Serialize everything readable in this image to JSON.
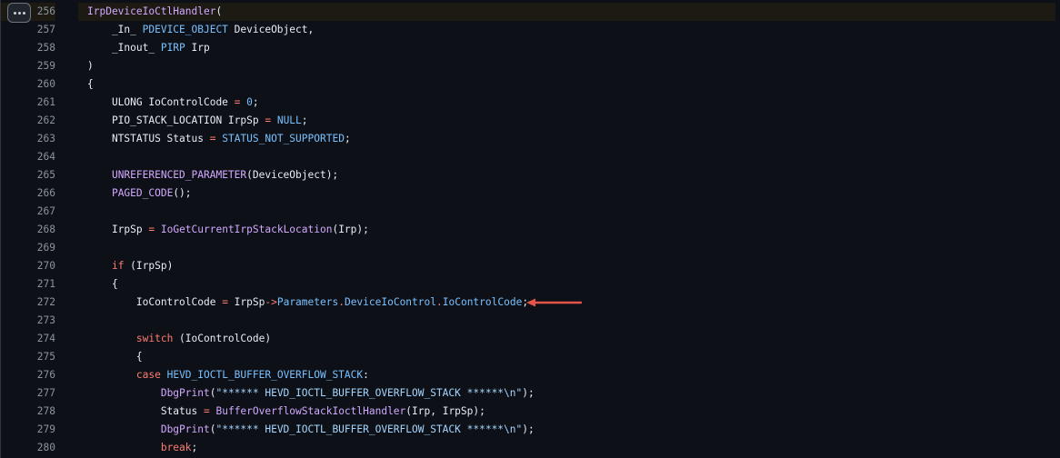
{
  "viewer": {
    "menu_button_icon": "kebab-horizontal-icon",
    "annotation_color": "#e5534b",
    "annotation_line": 272
  },
  "lines": [
    {
      "n": "256",
      "highlight": true,
      "tokens": [
        [
          "fn",
          "IrpDeviceIoCtlHandler"
        ],
        [
          "",
          "("
        ]
      ]
    },
    {
      "n": "257",
      "tokens": [
        [
          "",
          "    _In_ "
        ],
        [
          "ty",
          "PDEVICE_OBJECT"
        ],
        [
          "",
          " DeviceObject,"
        ]
      ]
    },
    {
      "n": "258",
      "tokens": [
        [
          "",
          "    _Inout_ "
        ],
        [
          "ty",
          "PIRP"
        ],
        [
          "",
          " Irp"
        ]
      ]
    },
    {
      "n": "259",
      "tokens": [
        [
          "",
          ")"
        ]
      ]
    },
    {
      "n": "260",
      "tokens": [
        [
          "",
          "{"
        ]
      ]
    },
    {
      "n": "261",
      "tokens": [
        [
          "",
          "    ULONG IoControlCode "
        ],
        [
          "kw",
          "="
        ],
        [
          "",
          " "
        ],
        [
          "num",
          "0"
        ],
        [
          "",
          ";"
        ]
      ]
    },
    {
      "n": "262",
      "tokens": [
        [
          "",
          "    PIO_STACK_LOCATION IrpSp "
        ],
        [
          "kw",
          "="
        ],
        [
          "",
          " "
        ],
        [
          "cst",
          "NULL"
        ],
        [
          "",
          ";"
        ]
      ]
    },
    {
      "n": "263",
      "tokens": [
        [
          "",
          "    NTSTATUS Status "
        ],
        [
          "kw",
          "="
        ],
        [
          "",
          " "
        ],
        [
          "cst",
          "STATUS_NOT_SUPPORTED"
        ],
        [
          "",
          ";"
        ]
      ]
    },
    {
      "n": "264",
      "tokens": []
    },
    {
      "n": "265",
      "tokens": [
        [
          "",
          "    "
        ],
        [
          "fn",
          "UNREFERENCED_PARAMETER"
        ],
        [
          "",
          "(DeviceObject);"
        ]
      ]
    },
    {
      "n": "266",
      "tokens": [
        [
          "",
          "    "
        ],
        [
          "fn",
          "PAGED_CODE"
        ],
        [
          "",
          "();"
        ]
      ]
    },
    {
      "n": "267",
      "tokens": []
    },
    {
      "n": "268",
      "tokens": [
        [
          "",
          "    IrpSp "
        ],
        [
          "kw",
          "="
        ],
        [
          "",
          " "
        ],
        [
          "fn",
          "IoGetCurrentIrpStackLocation"
        ],
        [
          "",
          "(Irp);"
        ]
      ]
    },
    {
      "n": "269",
      "tokens": []
    },
    {
      "n": "270",
      "tokens": [
        [
          "",
          "    "
        ],
        [
          "kw",
          "if"
        ],
        [
          "",
          " (IrpSp)"
        ]
      ]
    },
    {
      "n": "271",
      "tokens": [
        [
          "",
          "    {"
        ]
      ]
    },
    {
      "n": "272",
      "tokens": [
        [
          "",
          "        IoControlCode "
        ],
        [
          "kw",
          "="
        ],
        [
          "",
          " IrpSp"
        ],
        [
          "kw",
          "->"
        ],
        [
          "prop",
          "Parameters"
        ],
        [
          "kw",
          "."
        ],
        [
          "prop",
          "DeviceIoControl"
        ],
        [
          "kw",
          "."
        ],
        [
          "prop",
          "IoControlCode"
        ],
        [
          "",
          ";"
        ]
      ]
    },
    {
      "n": "273",
      "tokens": []
    },
    {
      "n": "274",
      "tokens": [
        [
          "",
          "        "
        ],
        [
          "kw",
          "switch"
        ],
        [
          "",
          " (IoControlCode)"
        ]
      ]
    },
    {
      "n": "275",
      "tokens": [
        [
          "",
          "        {"
        ]
      ]
    },
    {
      "n": "276",
      "tokens": [
        [
          "",
          "        "
        ],
        [
          "kw",
          "case"
        ],
        [
          "",
          " "
        ],
        [
          "cst",
          "HEVD_IOCTL_BUFFER_OVERFLOW_STACK"
        ],
        [
          "",
          ":"
        ]
      ]
    },
    {
      "n": "277",
      "tokens": [
        [
          "",
          "            "
        ],
        [
          "fn",
          "DbgPrint"
        ],
        [
          "",
          "("
        ],
        [
          "str",
          "\"****** HEVD_IOCTL_BUFFER_OVERFLOW_STACK ******\\n\""
        ],
        [
          "",
          ");"
        ]
      ]
    },
    {
      "n": "278",
      "tokens": [
        [
          "",
          "            Status "
        ],
        [
          "kw",
          "="
        ],
        [
          "",
          " "
        ],
        [
          "fn",
          "BufferOverflowStackIoctlHandler"
        ],
        [
          "",
          "(Irp, IrpSp);"
        ]
      ]
    },
    {
      "n": "279",
      "tokens": [
        [
          "",
          "            "
        ],
        [
          "fn",
          "DbgPrint"
        ],
        [
          "",
          "("
        ],
        [
          "str",
          "\"****** HEVD_IOCTL_BUFFER_OVERFLOW_STACK ******\\n\""
        ],
        [
          "",
          ");"
        ]
      ]
    },
    {
      "n": "280",
      "tokens": [
        [
          "",
          "            "
        ],
        [
          "kw",
          "break"
        ],
        [
          "",
          ";"
        ]
      ]
    }
  ]
}
